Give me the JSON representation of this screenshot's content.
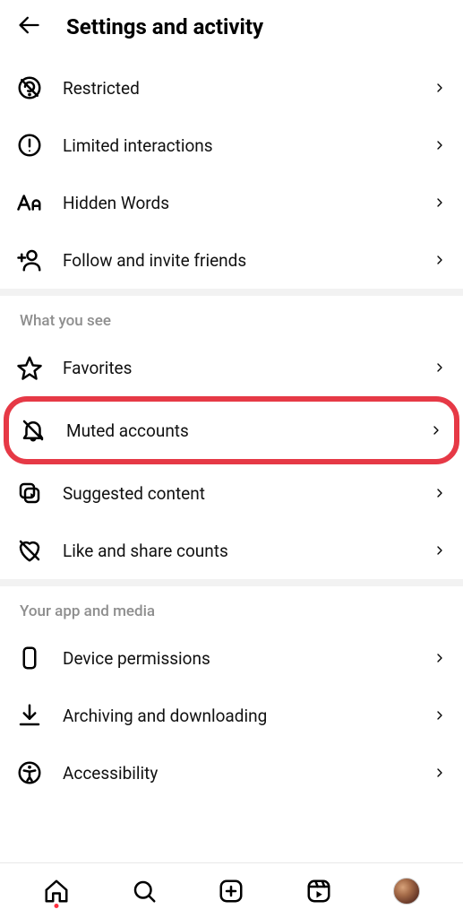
{
  "header": {
    "title": "Settings and activity"
  },
  "section1": {
    "items": [
      {
        "label": "Restricted"
      },
      {
        "label": "Limited interactions"
      },
      {
        "label": "Hidden Words"
      },
      {
        "label": "Follow and invite friends"
      }
    ]
  },
  "section2": {
    "header": "What you see",
    "items": [
      {
        "label": "Favorites"
      },
      {
        "label": "Muted accounts"
      },
      {
        "label": "Suggested content"
      },
      {
        "label": "Like and share counts"
      }
    ]
  },
  "section3": {
    "header": "Your app and media",
    "items": [
      {
        "label": "Device permissions"
      },
      {
        "label": "Archiving and downloading"
      },
      {
        "label": "Accessibility"
      }
    ]
  }
}
